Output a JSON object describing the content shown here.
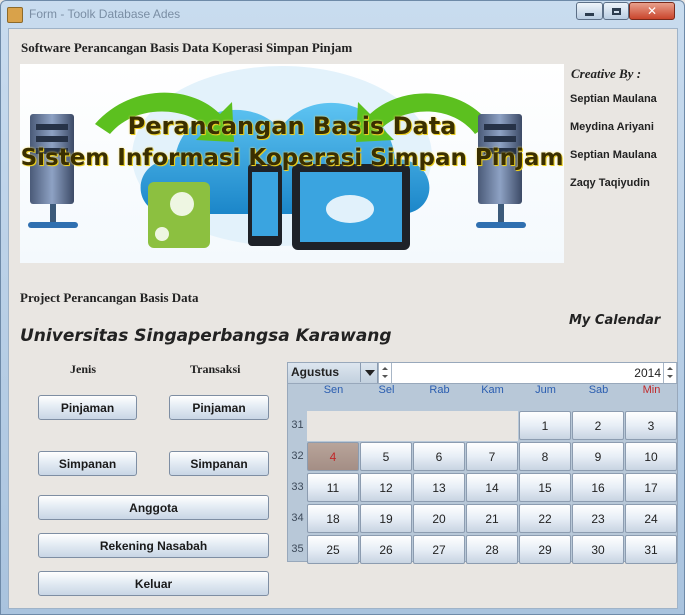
{
  "window": {
    "title": "Form - Toolk Database Ades"
  },
  "app": {
    "title": "Software Perancangan Basis Data Koperasi Simpan Pinjam",
    "banner": {
      "line1": "Perancangan Basis Data",
      "line2": "Sistem Informasi Koperasi Simpan Pinjam"
    },
    "credits": {
      "heading": "Creative By :",
      "names": [
        "Septian Maulana",
        "Meydina Ariyani",
        "Septian Maulana",
        "Zaqy Taqiyudin"
      ]
    },
    "project_label": "Project Perancangan Basis Data",
    "university": "Universitas Singaperbangsa Karawang",
    "calendar_label": "My Calendar"
  },
  "menu": {
    "col_jenis": "Jenis",
    "col_transaksi": "Transaksi",
    "pinjaman_jenis": "Pinjaman",
    "pinjaman_transaksi": "Pinjaman",
    "simpanan_jenis": "Simpanan",
    "simpanan_transaksi": "Simpanan",
    "anggota": "Anggota",
    "rekening": "Rekening Nasabah",
    "keluar": "Keluar"
  },
  "calendar": {
    "month": "Agustus",
    "year": "2014",
    "weekdays": [
      "Sen",
      "Sel",
      "Rab",
      "Kam",
      "Jum",
      "Sab",
      "Min"
    ],
    "week_numbers": [
      "31",
      "32",
      "33",
      "34",
      "35"
    ],
    "first_row_days": [
      "1",
      "2",
      "3"
    ],
    "days_from_4": [
      "4",
      "5",
      "6",
      "7",
      "8",
      "9",
      "10",
      "11",
      "12",
      "13",
      "14",
      "15",
      "16",
      "17",
      "18",
      "19",
      "20",
      "21",
      "22",
      "23",
      "24",
      "25",
      "26",
      "27",
      "28",
      "29",
      "30",
      "31"
    ],
    "selected_day": "4",
    "colors": {
      "weekday": "#2a5db0",
      "sunday": "#c0282a",
      "selected_bg": "#a99188"
    }
  }
}
